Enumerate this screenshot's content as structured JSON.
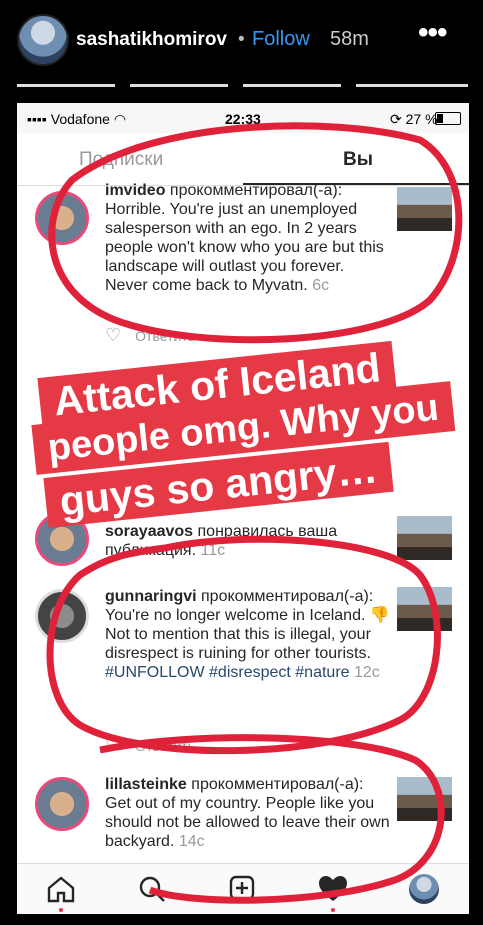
{
  "story": {
    "username": "sashatikhomirov",
    "follow_label": "Follow",
    "age": "58m",
    "more_icon": "more-horizontal-icon"
  },
  "status_bar": {
    "carrier": "Vodafone",
    "time": "22:33",
    "battery": "27 %"
  },
  "tabs": {
    "following": "Подписки",
    "you": "Вы"
  },
  "notifications": [
    {
      "user": "imvideo",
      "action": "прокомментировал(-а):",
      "text": "Horrible. You're just an unemployed salesperson with an ego. In 2 years people won't know who you are but this landscape will outlast you forever. Never come back to Myvatn.",
      "ago": "6с",
      "reply": "Ответить"
    },
    {
      "user": "sorayaavos",
      "action": "понравилась ваша публикация.",
      "ago": "11с"
    },
    {
      "user": "gunnaringvi",
      "action": "прокомментировал(-а):",
      "text": "You're no longer welcome in Iceland. 👎 Not to mention that this is illegal, your disrespect is ruining for other tourists.",
      "hashtags": "#UNFOLLOW #disrespect #nature",
      "ago": "12с",
      "reply": "Ответить"
    },
    {
      "user": "lillasteinke",
      "action": "прокомментировал(-а):",
      "text": "Get out of my country. People like you should not be allowed to leave their own backyard.",
      "ago": "14с"
    }
  ],
  "sticker_text": {
    "line1": "Attack of Iceland",
    "line2": "people omg. Why you",
    "line3": "guys so angry…"
  },
  "colors": {
    "follow": "#3897f0",
    "sticker_bg": "#e63946",
    "scribble": "#e0213a"
  }
}
